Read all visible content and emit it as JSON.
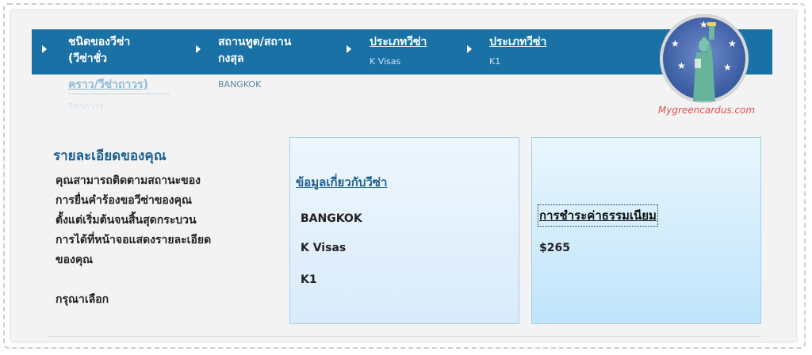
{
  "breadcrumb": {
    "steps": [
      {
        "title_line1": "ชนิดของวีซ่า",
        "title_line2": "(วีซ่าชั่ว",
        "title_line3": "คราว/วีซ่าถาวร)",
        "sub": "วีซ่าถาวร"
      },
      {
        "title_line1": "สถานทูต/สถาน",
        "title_line2": "กงสุล",
        "sub": "BANGKOK"
      },
      {
        "title_line1": "ประเภทวีซ่า",
        "sub": "K Visas"
      },
      {
        "title_line1": "ประเภทวีซ่า",
        "sub": "K1"
      }
    ]
  },
  "logo": {
    "text": "Mygreencardus.com"
  },
  "details": {
    "heading": "รายละเอียดของคุณ",
    "lines": [
      "คุณสามารถติดตามสถานะของ",
      "การยื่นคำร้องขอวีซ่าของคุณ",
      "ตั้งแต่เริ่มต้นจนสิ้นสุดกระบวน",
      "การได้ที่หน้าจอแสดงรายละเอียด",
      "ของคุณ"
    ],
    "choose": "กรุณาเลือก"
  },
  "visa_info": {
    "heading": "ข้อมูลเกี่ยวกับวีซ่า",
    "post": "BANGKOK",
    "category": "K Visas",
    "type": "K1"
  },
  "fee": {
    "heading": "การชำระค่าธรรมเนียม",
    "amount": "$265"
  },
  "colors": {
    "bar": "#1a71a6",
    "heading": "#1a5e8f",
    "logo_text": "#d9534f"
  }
}
